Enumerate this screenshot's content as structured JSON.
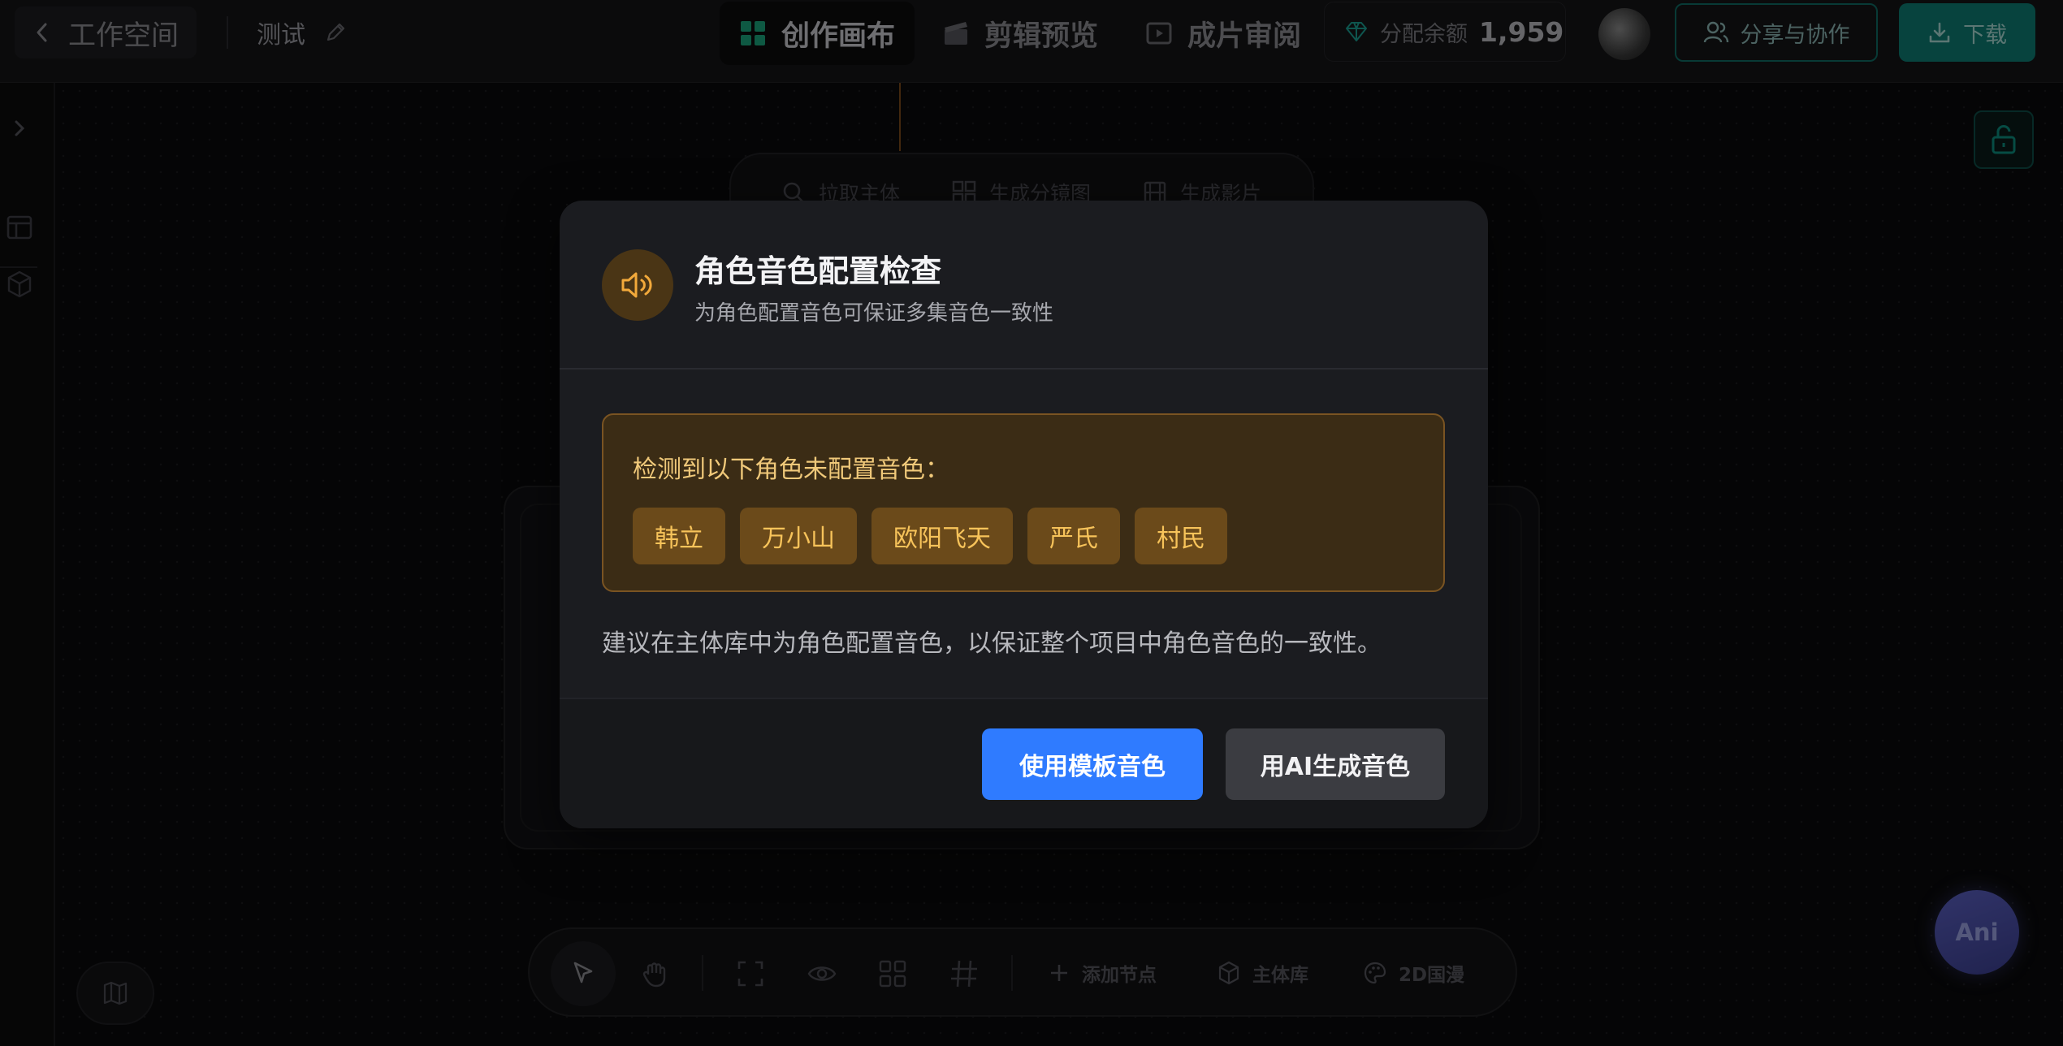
{
  "header": {
    "back_label": "工作空间",
    "project_name": "测试",
    "tabs": [
      {
        "label": "创作画布",
        "icon": "grid-icon",
        "active": true
      },
      {
        "label": "剪辑预览",
        "icon": "clapperboard-icon",
        "active": false
      },
      {
        "label": "成片审阅",
        "icon": "film-review-icon",
        "active": false
      }
    ],
    "balance_label": "分配余额",
    "balance_value": "1,959",
    "share_label": "分享与协作",
    "download_label": "下载"
  },
  "canvas": {
    "float_toolbar": [
      {
        "label": "拉取主体",
        "icon": "search-icon"
      },
      {
        "label": "生成分镜图",
        "icon": "grid-icon"
      },
      {
        "label": "生成影片",
        "icon": "film-icon"
      }
    ],
    "ani_label": "Ani"
  },
  "bottom_toolbar": {
    "add_node_label": "添加节点",
    "subject_library_label": "主体库",
    "style_label": "2D国漫"
  },
  "modal": {
    "title": "角色音色配置检查",
    "subtitle": "为角色配置音色可保证多集音色一致性",
    "warning_text": "检测到以下角色未配置音色：",
    "characters": [
      "韩立",
      "万小山",
      "欧阳飞天",
      "严氏",
      "村民"
    ],
    "advice": "建议在主体库中为角色配置音色，以保证整个项目中角色音色的一致性。",
    "primary_button": "使用模板音色",
    "secondary_button": "用AI生成音色"
  },
  "colors": {
    "accent_blue": "#2f7bff",
    "accent_teal": "#0d7a72",
    "warning_amber": "#f7c35a",
    "modal_bg": "#1b1c20"
  }
}
